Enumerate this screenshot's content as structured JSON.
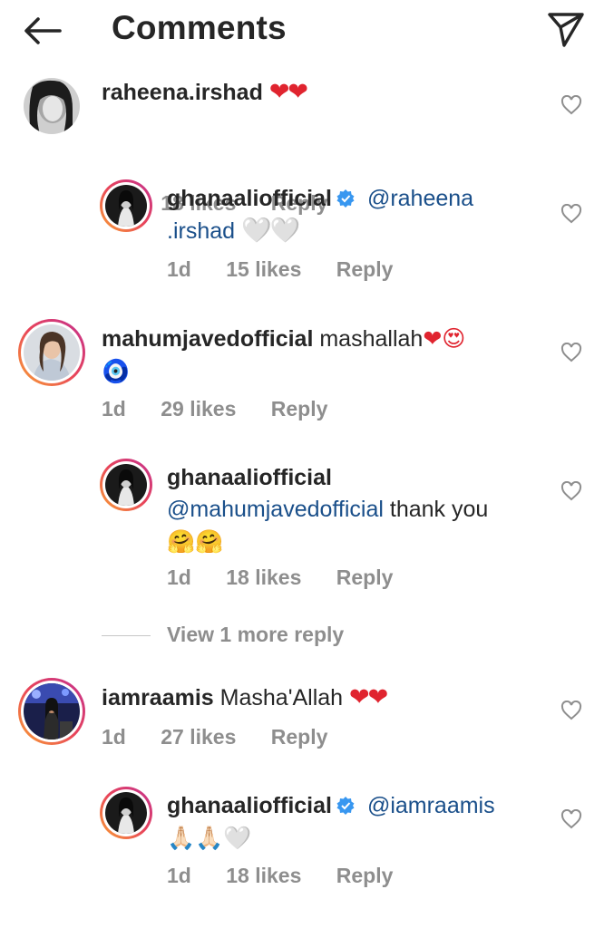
{
  "header": {
    "title": "Comments",
    "back_icon": "arrow-left-icon",
    "share_icon": "paper-plane-icon"
  },
  "comments": [
    {
      "username": "raheena.irshad",
      "text": "",
      "emojis": "❤❤",
      "age": "1d",
      "likes": "18 likes",
      "reply_label": "Reply"
    },
    {
      "username": "ghanaaliofficial",
      "mention_a": "@raheena",
      "mention_b": ".irshad",
      "emojis": "🤍🤍",
      "age": "1d",
      "likes": "15 likes",
      "reply_label": "Reply"
    },
    {
      "username": "mahumjavedofficial",
      "text": "mashallah",
      "emojis": "❤😍",
      "emoji_line2": "🧿",
      "age": "1d",
      "likes": "29 likes",
      "reply_label": "Reply"
    },
    {
      "username": "ghanaaliofficial",
      "mention": "@mahumjavedofficial",
      "text": "thank you",
      "emojis": "🤗🤗",
      "age": "1d",
      "likes": "18 likes",
      "reply_label": "Reply"
    },
    {
      "username": "iamraamis",
      "text": "Masha'Allah",
      "emojis": "❤❤",
      "age": "1d",
      "likes": "27 likes",
      "reply_label": "Reply"
    },
    {
      "username": "ghanaaliofficial",
      "mention": "@iamraamis",
      "emojis": "🙏🏻🙏🏻🤍",
      "age": "1d",
      "likes": "18 likes",
      "reply_label": "Reply"
    }
  ],
  "view_more_replies": "View 1 more reply",
  "colors": {
    "accent_link": "#1a4f8a",
    "verified_blue": "#3897f0",
    "heart_red": "#e0242f",
    "muted": "#8e8e8e"
  }
}
